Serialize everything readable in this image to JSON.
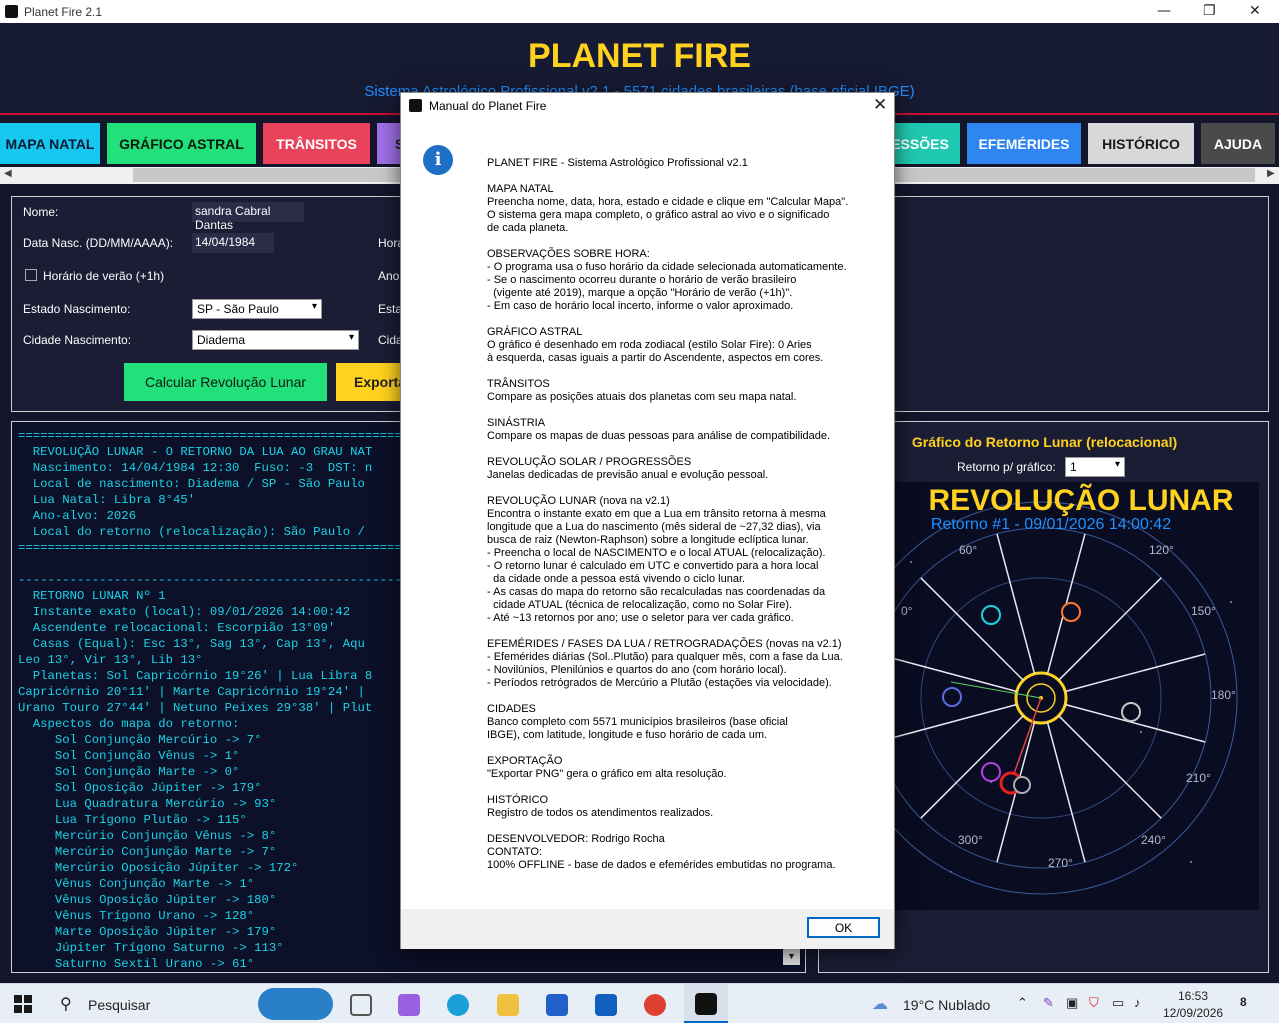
{
  "window": {
    "title": "Planet Fire 2.1",
    "min": "—",
    "restore": "❐",
    "close": "✕"
  },
  "header": {
    "title": "PLANET FIRE",
    "subtitle": "Sistema Astrológico Profissional v2.1 - 5571 cidades brasileiras (base oficial IBGE)"
  },
  "tabs": [
    {
      "label": "MAPA NATAL",
      "bg": "#16c8f0",
      "fg": "#0b1a33"
    },
    {
      "label": "GRÁFICO ASTRAL",
      "bg": "#22e07a",
      "fg": "#0b1a10"
    },
    {
      "label": "TRÂNSITOS",
      "bg": "#e8435a",
      "fg": "#ffffff"
    },
    {
      "label": "S",
      "bg": "#a070e8",
      "fg": "#1a1a1a"
    },
    {
      "label": "ESSÕES",
      "bg": "#1fc8b0",
      "fg": "#ffffff"
    },
    {
      "label": "EFEMÉRIDES",
      "bg": "#2f86f0",
      "fg": "#ffffff"
    },
    {
      "label": "HISTÓRICO",
      "bg": "#d8d8d8",
      "fg": "#1a1a1a"
    },
    {
      "label": "AJUDA",
      "bg": "#4a4a4a",
      "fg": "#ffffff"
    }
  ],
  "form": {
    "name_label": "Nome:",
    "name_value": "sandra Cabral Dantas",
    "date_label": "Data Nasc. (DD/MM/AAAA):",
    "date_value": "14/04/1984",
    "dst_label": "Horário de verão (+1h)",
    "state_label": "Estado Nascimento:",
    "state_value": "SP - São Paulo",
    "city_label": "Cidade Nascimento:",
    "city_value": "Diadema",
    "hour_label": "Hora",
    "year_label": "Ano",
    "state2_label": "Esta",
    "city2_label": "Cida",
    "calc_button": "Calcular Revolução Lunar",
    "export_button": "Exporta"
  },
  "output": {
    "lines": [
      "=====================================================",
      "  REVOLUÇÃO LUNAR - O RETORNO DA LUA AO GRAU NAT",
      "  Nascimento: 14/04/1984 12:30  Fuso: -3  DST: n",
      "  Local de nascimento: Diadema / SP - São Paulo",
      "  Lua Natal: Libra 8°45'",
      "  Ano-alvo: 2026",
      "  Local do retorno (relocalização): São Paulo /",
      "=====================================================",
      "",
      "-----------------------------------------------------",
      "  RETORNO LUNAR Nº 1",
      "  Instante exato (local): 09/01/2026 14:00:42",
      "  Ascendente relocacional: Escorpião 13°09'",
      "  Casas (Equal): Esc 13°, Sag 13°, Cap 13°, Aqu",
      "Leo 13°, Vir 13°, Lib 13°",
      "  Planetas: Sol Capricórnio 19°26' | Lua Libra 8",
      "Capricórnio 20°11' | Marte Capricórnio 19°24' |",
      "Urano Touro 27°44' | Netuno Peixes 29°38' | Plut",
      "  Aspectos do mapa do retorno:",
      "     Sol Conjunção Mercúrio -> 7°",
      "     Sol Conjunção Vênus -> 1°",
      "     Sol Conjunção Marte -> 0°",
      "     Sol Oposição Júpiter -> 179°",
      "     Lua Quadratura Mercúrio -> 93°",
      "     Lua Trígono Plutão -> 115°",
      "     Mercúrio Conjunção Vênus -> 8°",
      "     Mercúrio Conjunção Marte -> 7°",
      "     Mercúrio Oposição Júpiter -> 172°",
      "     Vênus Conjunção Marte -> 1°",
      "     Vênus Oposição Júpiter -> 180°",
      "     Vênus Trígono Urano -> 128°",
      "     Marte Oposição Júpiter -> 179°",
      "     Júpiter Trígono Saturno -> 113°",
      "     Saturno Sextil Urano -> 61°"
    ]
  },
  "chart": {
    "title": "Gráfico do Retorno Lunar (relocacional)",
    "selector_label": "Retorno p/ gráfico:",
    "selector_value": "1",
    "heading": "REVOLUÇÃO LUNAR",
    "subheading": "Retorno #1 - 09/01/2026 14:00:42",
    "degree_labels": [
      "60°",
      "120°",
      "150°",
      "180°",
      "210°",
      "240°",
      "270°",
      "300°",
      "0°"
    ]
  },
  "dialog": {
    "title": "Manual do Planet Fire",
    "body": "PLANET FIRE - Sistema Astrológico Profissional v2.1\n\nMAPA NATAL\nPreencha nome, data, hora, estado e cidade e clique em \"Calcular Mapa\".\nO sistema gera mapa completo, o gráfico astral ao vivo e o significado\nde cada planeta.\n\nOBSERVAÇÕES SOBRE HORA:\n- O programa usa o fuso horário da cidade selecionada automaticamente.\n- Se o nascimento ocorreu durante o horário de verão brasileiro\n  (vigente até 2019), marque a opção \"Horário de verão (+1h)\".\n- Em caso de horário local incerto, informe o valor aproximado.\n\nGRÁFICO ASTRAL\nO gráfico é desenhado em roda zodiacal (estilo Solar Fire): 0 Aries\nà esquerda, casas iguais a partir do Ascendente, aspectos em cores.\n\nTRÂNSITOS\nCompare as posições atuais dos planetas com seu mapa natal.\n\nSINÁSTRIA\nCompare os mapas de duas pessoas para análise de compatibilidade.\n\nREVOLUÇÃO SOLAR / PROGRESSÕES\nJanelas dedicadas de previsão anual e evolução pessoal.\n\nREVOLUÇÃO LUNAR (nova na v2.1)\nEncontra o instante exato em que a Lua em trânsito retorna à mesma\nlongitude que a Lua do nascimento (mês sideral de ~27,32 dias), via\nbusca de raiz (Newton-Raphson) sobre a longitude eclíptica lunar.\n- Preencha o local de NASCIMENTO e o local ATUAL (relocalização).\n- O retorno lunar é calculado em UTC e convertido para a hora local\n  da cidade onde a pessoa está vivendo o ciclo lunar.\n- As casas do mapa do retorno são recalculadas nas coordenadas da\n  cidade ATUAL (técnica de relocalização, como no Solar Fire).\n- Até ~13 retornos por ano; use o seletor para ver cada gráfico.\n\nEFEMÉRIDES / FASES DA LUA / RETROGRADAÇÕES (novas na v2.1)\n- Efemérides diárias (Sol..Plutão) para qualquer mês, com a fase da Lua.\n- Novilúnios, Plenilúnios e quartos do ano (com horário local).\n- Períodos retrógrados de Mercúrio a Plutão (estações via velocidade).\n\nCIDADES\nBanco completo com 5571 municípios brasileiros (base oficial\nIBGE), com latitude, longitude e fuso horário de cada um.\n\nEXPORTAÇÃO\n\"Exportar PNG\" gera o gráfico em alta resolução.\n\nHISTÓRICO\nRegistro de todos os atendimentos realizados.\n\nDESENVOLVEDOR: Rodrigo Rocha\nCONTATO:\n100% OFFLINE - base de dados e efemérides embutidas no programa.",
    "ok": "OK"
  },
  "taskbar": {
    "search": "Pesquisar",
    "weather": "19°C  Nublado",
    "time": "16:53",
    "date": "12/09/2026",
    "notif": "8"
  }
}
